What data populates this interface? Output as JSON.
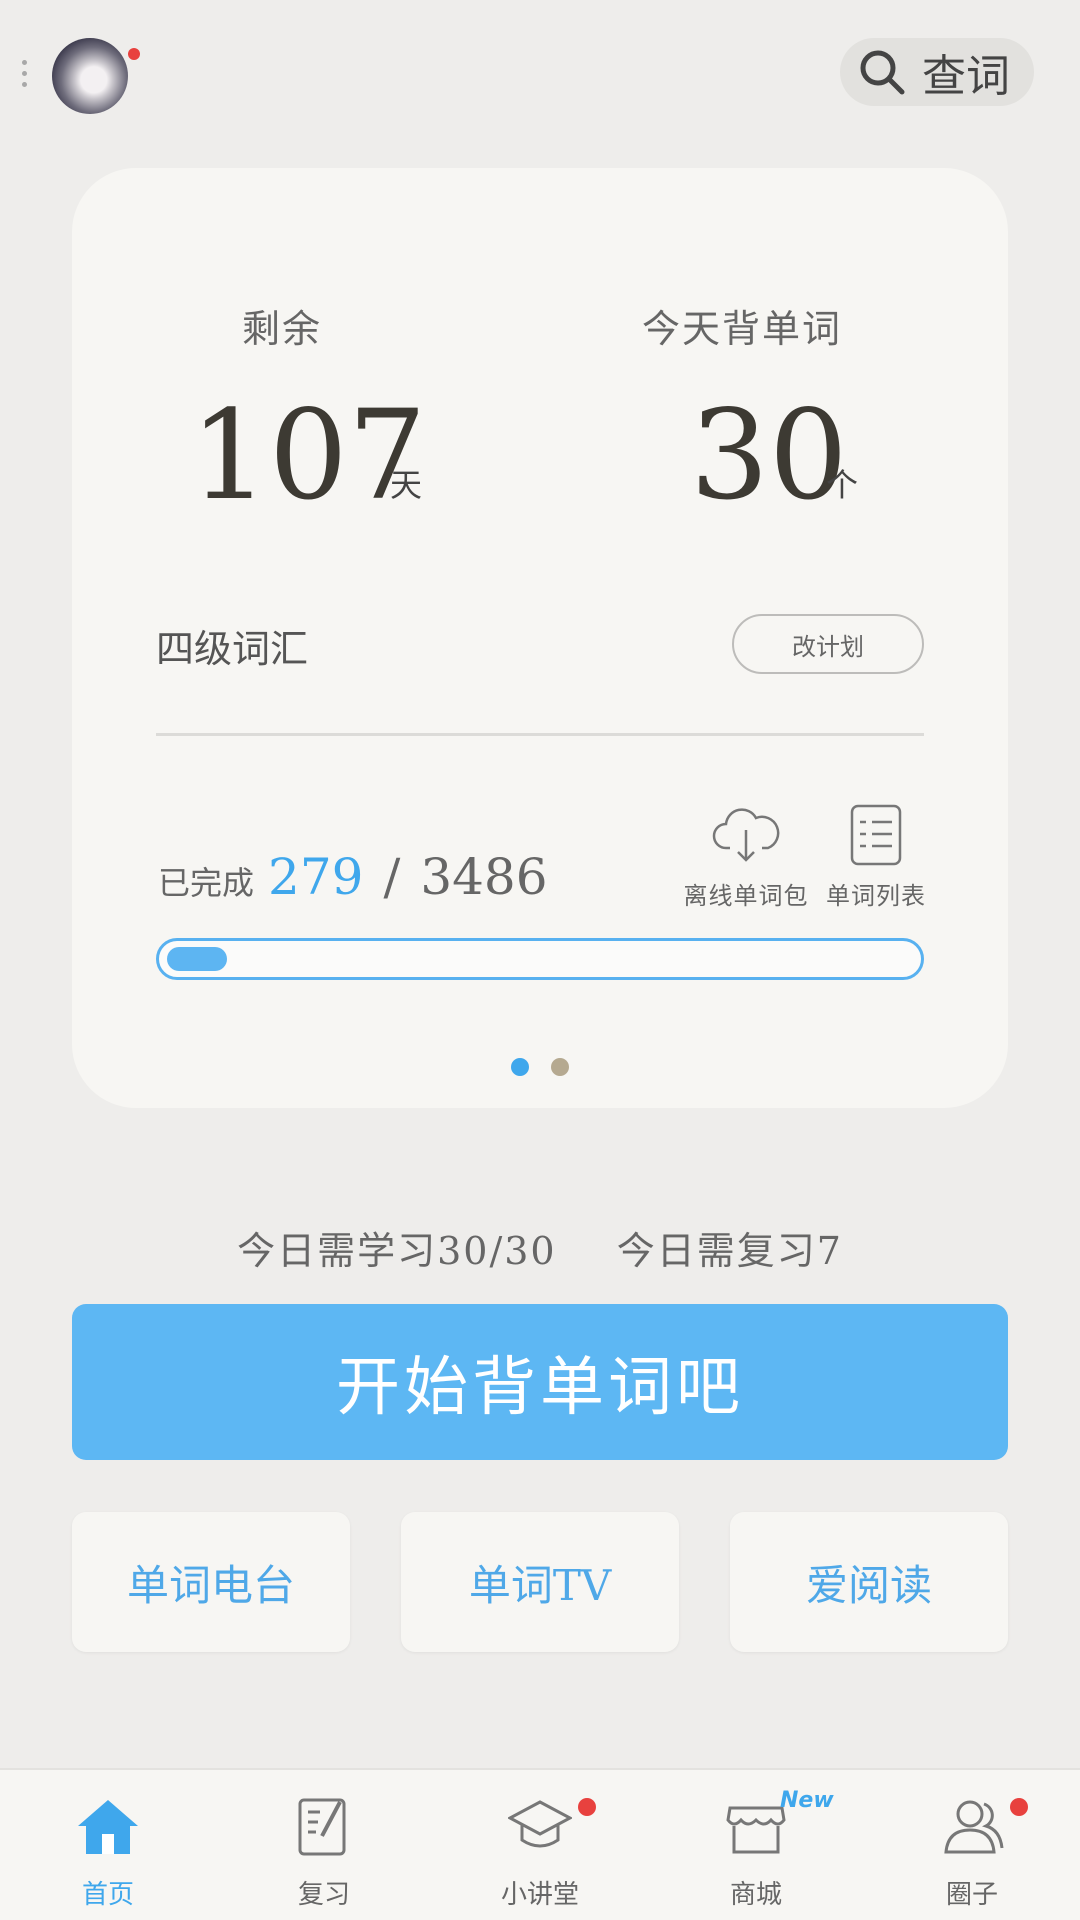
{
  "header": {
    "search_label": "查词"
  },
  "plan": {
    "remaining_caption": "剩余",
    "remaining_value": "107",
    "remaining_unit": "天",
    "today_caption": "今天背单词",
    "today_value": "30",
    "today_unit": "个",
    "book_name": "四级词汇",
    "change_plan_label": "改计划",
    "completed_prefix": "已完成",
    "completed_count": "279",
    "separator": "/",
    "total_count": "3486",
    "progress_fraction": 0.08,
    "offline_label": "离线单词包",
    "wordlist_label": "单词列表",
    "page_count": 2,
    "active_page": 0
  },
  "today": {
    "learn_text": "今日需学习30/30",
    "review_text": "今日需复习7"
  },
  "start_button_label": "开始背单词吧",
  "quick_links": [
    {
      "label": "单词电台"
    },
    {
      "label": "单词TV"
    },
    {
      "label": "爱阅读"
    }
  ],
  "tabs": [
    {
      "label": "首页",
      "icon": "home-icon",
      "active": true
    },
    {
      "label": "复习",
      "icon": "review-icon",
      "badge": false
    },
    {
      "label": "小讲堂",
      "icon": "graduation-cap-icon",
      "badge": true
    },
    {
      "label": "商城",
      "icon": "shop-icon",
      "tag": "New"
    },
    {
      "label": "圈子",
      "icon": "people-icon",
      "badge": true
    }
  ],
  "colors": {
    "accent": "#3fa7ec",
    "button": "#5db7f3",
    "badge": "#e8413e",
    "background": "#eeedeb",
    "card": "#f7f6f3"
  }
}
